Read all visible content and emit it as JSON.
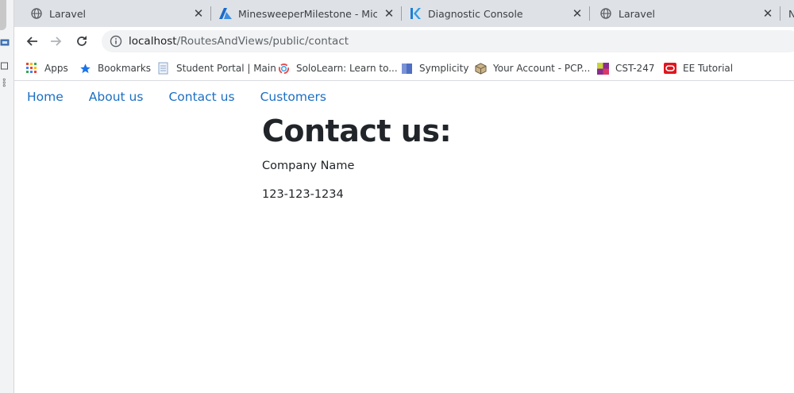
{
  "tabs": [
    {
      "title": "Laravel",
      "icon": "globe-icon"
    },
    {
      "title": "MinesweeperMilestone - Microsc",
      "icon": "azure-icon"
    },
    {
      "title": "Diagnostic Console",
      "icon": "kudu-icon"
    },
    {
      "title": "Laravel",
      "icon": "globe-icon"
    },
    {
      "title": "N",
      "icon": ""
    }
  ],
  "tab_close_glyph": "✕",
  "address": {
    "host": "localhost",
    "path": "/RoutesAndViews/public/contact"
  },
  "bookmarks": [
    {
      "label": "Apps",
      "icon": "apps-grid-icon"
    },
    {
      "label": "Bookmarks",
      "icon": "star-icon"
    },
    {
      "label": "Student Portal | Main",
      "icon": "page-icon"
    },
    {
      "label": "SoloLearn: Learn to...",
      "icon": "sololearn-icon"
    },
    {
      "label": "Symplicity",
      "icon": "symplicity-icon"
    },
    {
      "label": "Your Account - PCP...",
      "icon": "box-icon"
    },
    {
      "label": "CST-247",
      "icon": "cst-icon"
    },
    {
      "label": "EE Tutorial",
      "icon": "oracle-icon"
    }
  ],
  "site_nav": [
    {
      "label": "Home"
    },
    {
      "label": "About us"
    },
    {
      "label": "Contact us"
    },
    {
      "label": "Customers"
    }
  ],
  "content": {
    "heading": "Contact us:",
    "company": "Company Name",
    "phone": "123-123-1234"
  },
  "colors": {
    "link": "#1a6fc4",
    "tabbar": "#dee1e6",
    "omnibox": "#f1f3f4"
  }
}
